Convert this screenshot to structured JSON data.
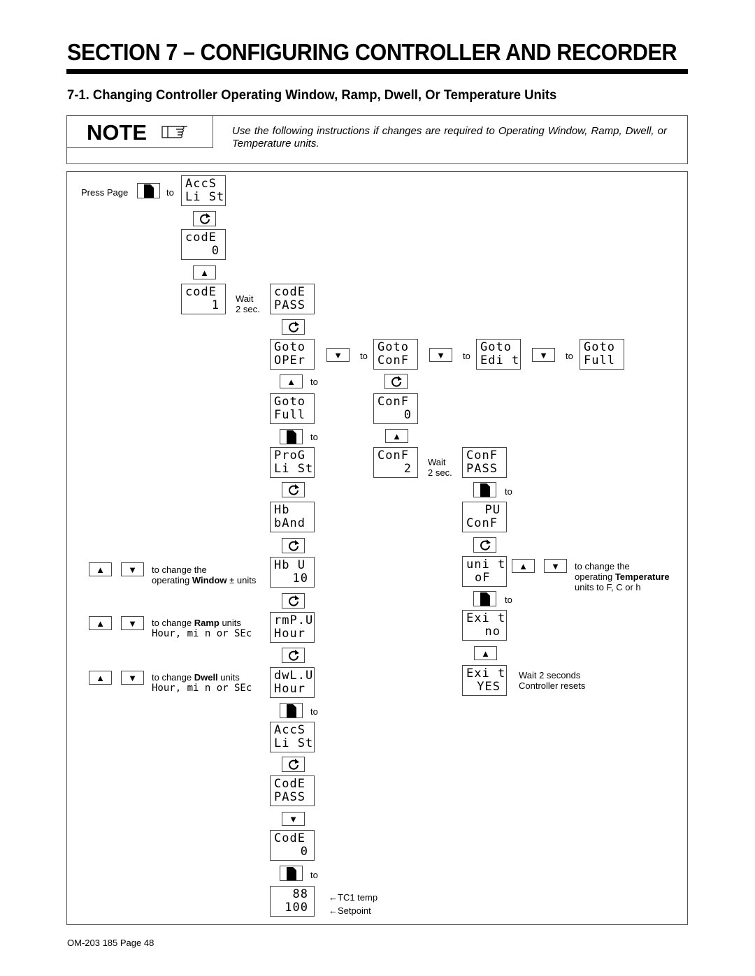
{
  "section_title": "SECTION 7 – CONFIGURING CONTROLLER AND RECORDER",
  "subsection_title": "7-1.   Changing Controller Operating Window, Ramp, Dwell, Or Temperature Units",
  "note": {
    "label": "NOTE",
    "icon": "pointing-hand-icon",
    "text": "Use the following instructions if changes are required to Operating Window, Ramp, Dwell, or Temperature units."
  },
  "procedure": {
    "press_page": "Press Page",
    "to": "to",
    "wait_2sec_line1": "Wait",
    "wait_2sec_line2": "2 sec.",
    "displays": {
      "accs_list": [
        "AccS",
        "Li St"
      ],
      "code_0": [
        "codE",
        "0"
      ],
      "code_1": [
        "codE",
        "1"
      ],
      "code_pass": [
        "codE",
        "PASS"
      ],
      "goto_oper": [
        "Goto",
        "OPEr"
      ],
      "goto_conf": [
        "Goto",
        "ConF"
      ],
      "goto_edit": [
        "Goto",
        "Edi t"
      ],
      "goto_full_a": [
        "Goto",
        "Full"
      ],
      "goto_full_b": [
        "Goto",
        "Full"
      ],
      "conf_0": [
        "ConF",
        "0"
      ],
      "prog_list": [
        "ProG",
        "Li St"
      ],
      "conf_2": [
        "ConF",
        "2"
      ],
      "conf_pass": [
        "ConF",
        "PASS"
      ],
      "hb_band": [
        "Hb",
        "bAnd"
      ],
      "pv_conf": [
        "PU",
        "ConF"
      ],
      "hb_u": [
        "Hb U",
        "10"
      ],
      "unit_of": [
        "uni t",
        "oF"
      ],
      "rmp_u": [
        "rmP.U",
        "Hour"
      ],
      "exit_no": [
        "Exi t",
        "no"
      ],
      "dwl_u": [
        "dwL.U",
        "Hour"
      ],
      "exit_yes": [
        "Exi t",
        "YES"
      ],
      "accs_list_2": [
        "AccS",
        "Li St"
      ],
      "code_pass_2": [
        "CodE",
        "PASS"
      ],
      "code_0_2": [
        "CodE",
        "0"
      ],
      "final": [
        "88",
        "100"
      ]
    },
    "window_instr": {
      "line1": "to change the",
      "line2_pre": "operating ",
      "line2_bold": "Window",
      "line2_post": " ± units"
    },
    "ramp_instr": {
      "pre": "to change ",
      "bold": "Ramp",
      "post": " units",
      "options": "Hour, mi n or SEc"
    },
    "dwell_instr": {
      "pre": "to change ",
      "bold": "Dwell",
      "post": " units",
      "options": "Hour, mi n or SEc"
    },
    "temp_instr": {
      "line1": "to change the",
      "line2_pre": "operating ",
      "line2_bold": "Temperature",
      "line3": "units to F, C or h"
    },
    "wait_seconds": {
      "line1": "Wait  2  seconds",
      "line2": "Controller resets"
    },
    "tc1_temp": "←TC1 temp",
    "setpoint": "←Setpoint"
  },
  "footer": "OM-203 185 Page 48"
}
